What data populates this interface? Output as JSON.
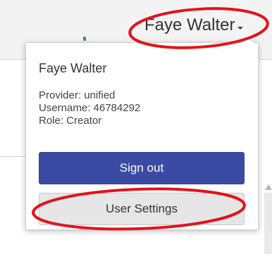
{
  "header": {
    "user_name": "Faye Walter"
  },
  "user_menu": {
    "display_name": "Faye Walter",
    "provider_line": "Provider: unified",
    "username_line": "Username: 46784292",
    "role_line": "Role: Creator",
    "sign_out_label": "Sign out",
    "user_settings_label": "User Settings"
  },
  "colors": {
    "sign_out_bg": "#3b4ba3",
    "settings_bg": "#e6e6e6",
    "annotation_red": "#e3121b"
  }
}
